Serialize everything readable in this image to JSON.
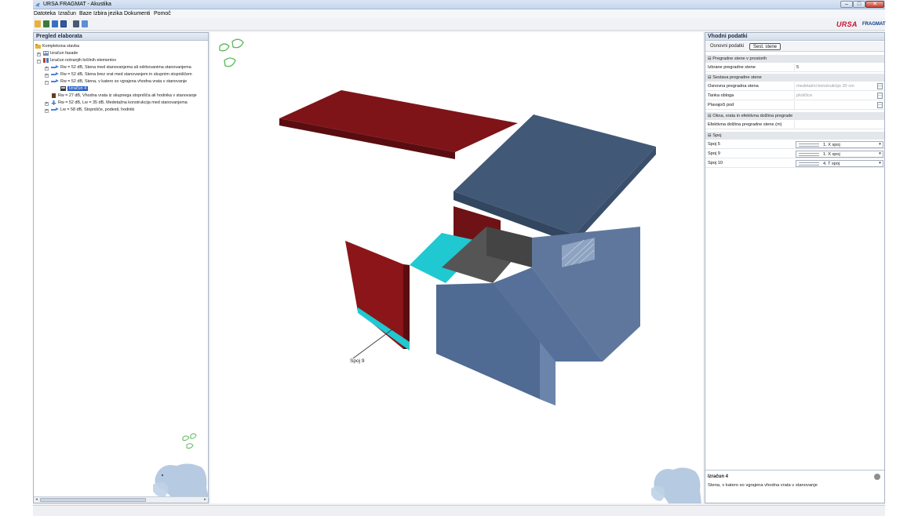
{
  "window": {
    "title": "URSA FRAGMAT - Akustika",
    "minimize_icon": "minimize-icon",
    "maximize_icon": "maximize-icon",
    "close_icon": "close-icon"
  },
  "menu": {
    "items": [
      "Datoteka",
      "Izračun",
      "Baze",
      "Izbira jezika",
      "Dokumenti",
      "Pomoč"
    ]
  },
  "toolbar": {
    "icons": [
      "open-folder-icon",
      "building-icon",
      "window-icon",
      "save-icon",
      "calculator-icon",
      "report-icon"
    ],
    "brand": "URSA",
    "brand_secondary": "FRAGMAT",
    "brand_color": "#c8102e"
  },
  "left_panel": {
    "title": "Pregled elaborata",
    "tree": [
      {
        "label": "Kompleksna stavba",
        "level": 0,
        "expander": "",
        "icon": "folder-icon"
      },
      {
        "label": "Izračun fasade",
        "level": 1,
        "expander": "+",
        "icon": "facade-icon"
      },
      {
        "label": "Izračun notranjih ločilnih elementov",
        "level": 1,
        "expander": "−",
        "icon": "partition-icon"
      },
      {
        "label": "Rw = 52 dB, Stena med stanovanjema ali odrbovanima stanovanjema",
        "level": 2,
        "expander": "+",
        "icon": "arrow-right-icon"
      },
      {
        "label": "Rw = 52 dB, Stena brez vrat med stanovanjem in skupnim stopniščem",
        "level": 2,
        "expander": "+",
        "icon": "arrow-right-icon"
      },
      {
        "label": "Rw = 52 dB, Stena, v katero so vgrajena vhodna vrata v stanovanje",
        "level": 2,
        "expander": "−",
        "icon": "arrow-right-icon"
      },
      {
        "label": "Izračun 4",
        "level": 3,
        "expander": "",
        "icon": "calculation-icon",
        "selected": true
      },
      {
        "label": "Rw = 27 dB, Vhodna vrata iz skupnega stopnišča ali hodnika v stanovanje",
        "level": 2,
        "expander": "",
        "icon": "door-icon"
      },
      {
        "label": "Rw = 52 dB, Lw = 35 dB, Medetažna konstrukcija med stanovanjema",
        "level": 2,
        "expander": "+",
        "icon": "arrow-down-icon"
      },
      {
        "label": "Lw = 58 dB, Stopnišče, podesti, hodniki",
        "level": 2,
        "expander": "+",
        "icon": "arrow-right-icon"
      }
    ],
    "decoration_icon": "butterfly-icon",
    "mascot_icon": "polar-bear-icon",
    "scroll_left_icon": "scroll-left-icon",
    "scroll_right_icon": "scroll-right-icon"
  },
  "viewport": {
    "label": "Spoj 9",
    "colors": {
      "wall_red": "#8b1518",
      "wall_blue": "#5c7499",
      "floor_cyan": "#1ec9d2",
      "wall_grey": "#555555"
    }
  },
  "right_panel": {
    "title": "Vhodni podatki",
    "tabs": [
      "Osnovni podatki",
      "Sest. stene"
    ],
    "active_tab": "Sest. stene",
    "sections": {
      "pregradne_stene": "Pregradne stene v prostorih",
      "sestava": "Sestava pregradne stene",
      "okna": "Okna, vrata in efektivna dolžina pregrade",
      "spoj": "Spoj"
    },
    "rows": {
      "izbrane_label": "Izbrane pregradne stene",
      "izbrane_value": "5",
      "osnovna_label": "Osnovna pregradna stena",
      "osnovna_value": "medetažni konstrukcijo 20 cm",
      "tanka_label": "Tanka obloga",
      "tanka_value": "ploščice",
      "plavajoci_label": "Plavajoči pod",
      "plavajoci_value": "",
      "efektivna_label": "Efektivna dolžina pregradne stene (m)",
      "efektivna_value": ""
    },
    "spoji": [
      {
        "label": "Spoj 5",
        "value": "1. X spoj"
      },
      {
        "label": "Spoj 9",
        "value": "1. X spoj"
      },
      {
        "label": "Spoj 10",
        "value": "4. T spoj"
      }
    ],
    "description": {
      "title": "Izračun 4",
      "text": "Stena, v katero so vgrajena vhodna vrata v stanovanje"
    }
  }
}
